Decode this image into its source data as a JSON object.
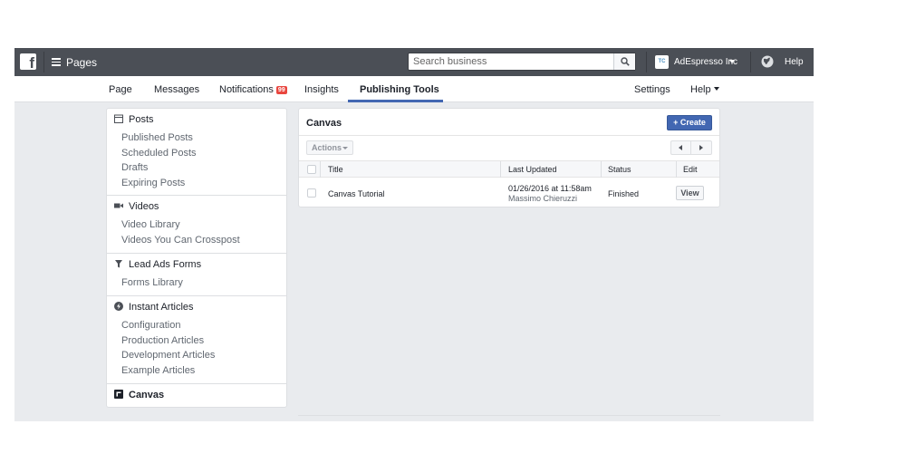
{
  "topbar": {
    "logo_letter": "f",
    "pages_label": "Pages",
    "search_placeholder": "Search business",
    "account_initials": "TC",
    "account_name": "AdEspresso Inc",
    "help_label": "Help"
  },
  "tabs": {
    "page": "Page",
    "messages": "Messages",
    "notifications": "Notifications",
    "notifications_badge": "99",
    "insights": "Insights",
    "publishing_tools": "Publishing Tools",
    "settings": "Settings",
    "help": "Help"
  },
  "sidebar": {
    "posts": {
      "title": "Posts",
      "items": [
        "Published Posts",
        "Scheduled Posts",
        "Drafts",
        "Expiring Posts"
      ]
    },
    "videos": {
      "title": "Videos",
      "items": [
        "Video Library",
        "Videos You Can Crosspost"
      ]
    },
    "lead_ads": {
      "title": "Lead Ads Forms",
      "items": [
        "Forms Library"
      ]
    },
    "instant_articles": {
      "title": "Instant Articles",
      "items": [
        "Configuration",
        "Production Articles",
        "Development Articles",
        "Example Articles"
      ]
    },
    "canvas": {
      "title": "Canvas"
    }
  },
  "main": {
    "title": "Canvas",
    "create_label": "+ Create",
    "actions_label": "Actions",
    "columns": {
      "title": "Title",
      "last_updated": "Last Updated",
      "status": "Status",
      "edit": "Edit"
    },
    "rows": [
      {
        "title": "Canvas Tutorial",
        "date": "01/26/2016 at 11:58am",
        "author": "Massimo Chieruzzi",
        "status": "Finished",
        "action": "View"
      }
    ]
  }
}
